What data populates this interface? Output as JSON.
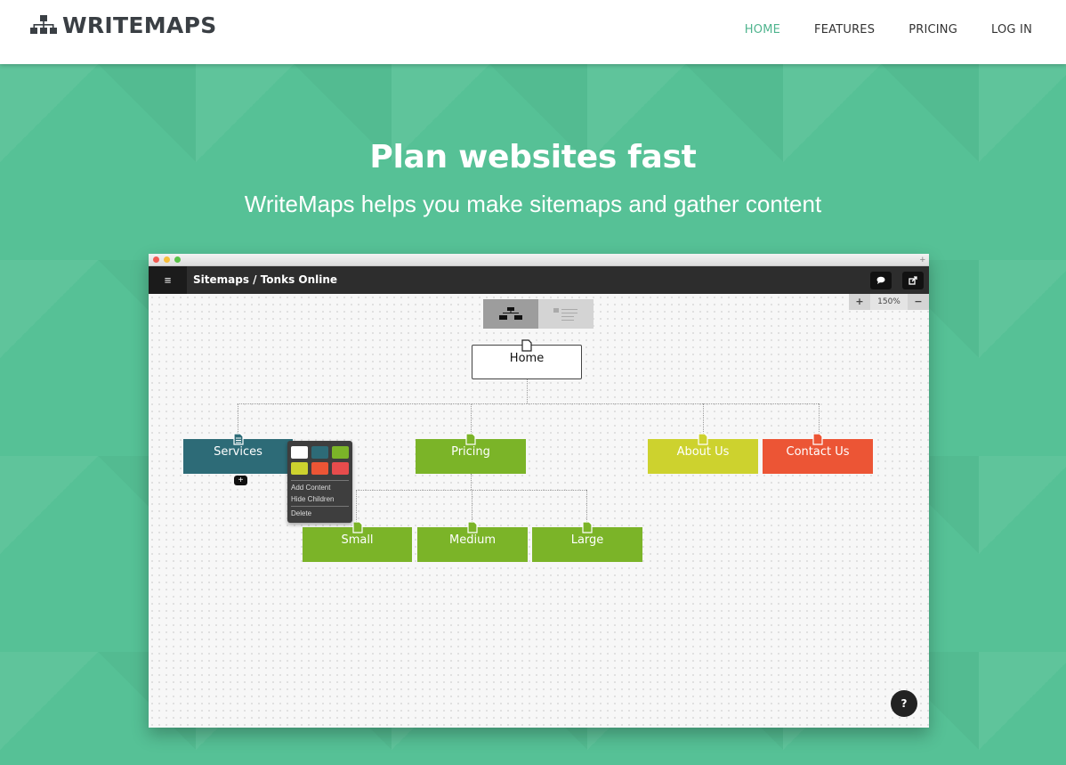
{
  "header": {
    "brand": "WRITEMAPS",
    "nav": [
      "HOME",
      "FEATURES",
      "PRICING",
      "LOG IN"
    ],
    "active_nav": "HOME"
  },
  "hero": {
    "title": "Plan websites fast",
    "subtitle": "WriteMaps helps you make sitemaps and gather content"
  },
  "app": {
    "breadcrumb": "Sitemaps / Tonks Online",
    "zoom_minus": "−",
    "zoom_value": "150%",
    "zoom_plus": "+",
    "nodes": {
      "home": "Home",
      "services": "Services",
      "pricing": "Pricing",
      "about": "About Us",
      "contact": "Contact Us",
      "small": "Small",
      "medium": "Medium",
      "large": "Large"
    },
    "context_menu": {
      "add_content": "Add Content",
      "hide_children": "Hide Children",
      "delete": "Delete"
    },
    "add_badge": "+",
    "help": "?"
  },
  "colors": {
    "accent": "#4fb48e",
    "hero_bg": "#56c196",
    "teal_node": "#2d6b77",
    "green_node": "#7bb428",
    "yellow_node": "#cdd22e",
    "orange_node": "#ec5535",
    "swatches": [
      "#ffffff",
      "#2d6b77",
      "#7bb428",
      "#cdd22e",
      "#ec5535",
      "#e74c4c"
    ]
  },
  "icons": {
    "brand": "sitemap-icon",
    "menu": "hamburger-icon",
    "comment": "comment-icon",
    "share": "share-icon",
    "page": "page-icon",
    "help": "help-icon"
  }
}
